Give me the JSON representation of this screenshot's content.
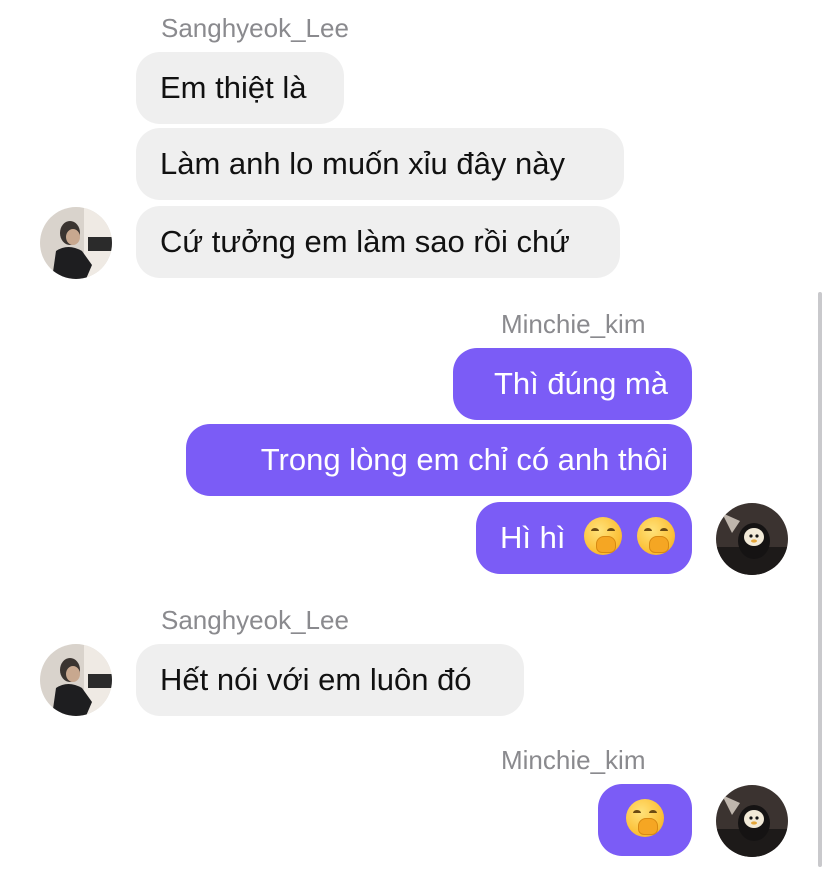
{
  "colors": {
    "incoming_bubble": "#efefef",
    "outgoing_bubble": "#7b5cf6",
    "sender_name": "#8a8a8e"
  },
  "messages": [
    {
      "group": 1,
      "sender": "Sanghyeok_Lee",
      "direction": "incoming",
      "bubbles": [
        "Em thiệt là",
        "Làm anh lo muốn xỉu đây này",
        "Cứ tưởng em làm sao rồi chứ"
      ]
    },
    {
      "group": 2,
      "sender": "Minchie_kim",
      "direction": "outgoing",
      "bubbles": [
        "Thì đúng mà",
        "Trong lòng em chỉ có anh thôi",
        "Hì hì"
      ],
      "emoji": "hand-over-mouth-emoji"
    },
    {
      "group": 3,
      "sender": "Sanghyeok_Lee",
      "direction": "incoming",
      "bubbles": [
        "Hết nói với em luôn đó"
      ]
    },
    {
      "group": 4,
      "sender": "Minchie_kim",
      "direction": "outgoing",
      "bubbles": [],
      "emoji": "hand-over-mouth-emoji"
    }
  ],
  "avatars": {
    "incoming": "person-at-piano-avatar",
    "outgoing": "plush-toy-avatar"
  }
}
